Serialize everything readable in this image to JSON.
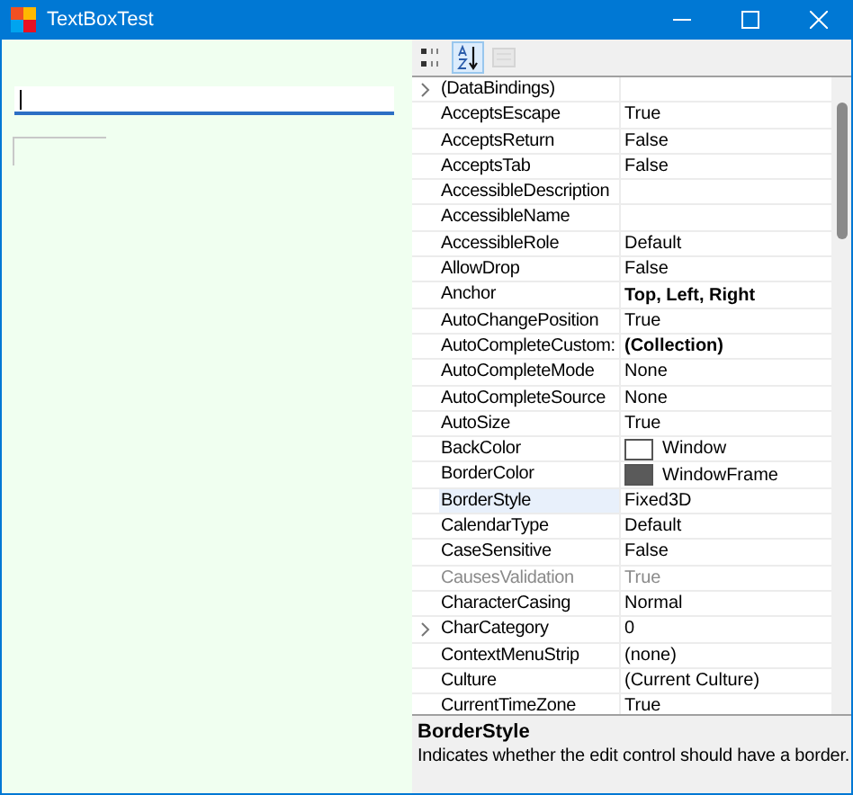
{
  "window": {
    "title": "TextBoxTest"
  },
  "form": {
    "textbox_focused": true
  },
  "toolbar": [
    {
      "kind": "categorized",
      "selected": false,
      "disabled": false
    },
    {
      "kind": "alphabetical",
      "selected": true,
      "disabled": false
    },
    {
      "kind": "pages",
      "selected": false,
      "disabled": true
    }
  ],
  "properties": [
    {
      "name": "(DataBindings)",
      "kind": "plain",
      "expandable": true,
      "disabled": false,
      "selected": false
    },
    {
      "name": "AcceptsEscape",
      "value": "True",
      "kind": "plain",
      "disabled": false,
      "selected": false
    },
    {
      "name": "AcceptsReturn",
      "value": "False",
      "kind": "plain",
      "disabled": false,
      "selected": false
    },
    {
      "name": "AcceptsTab",
      "value": "False",
      "kind": "plain",
      "disabled": false,
      "selected": false
    },
    {
      "name": "AccessibleDescription",
      "kind": "plain",
      "disabled": false,
      "selected": false
    },
    {
      "name": "AccessibleName",
      "kind": "plain",
      "disabled": false,
      "selected": false
    },
    {
      "name": "AccessibleRole",
      "value": "Default",
      "kind": "plain",
      "disabled": false,
      "selected": false
    },
    {
      "name": "AllowDrop",
      "value": "False",
      "kind": "plain",
      "disabled": false,
      "selected": false
    },
    {
      "name": "Anchor",
      "value": "Top, Left, Right",
      "kind": "bold",
      "disabled": false,
      "selected": false
    },
    {
      "name": "AutoChangePosition",
      "value": "True",
      "kind": "plain",
      "disabled": false,
      "selected": false
    },
    {
      "name": "AutoCompleteCustom:",
      "value": "(Collection)",
      "kind": "bold",
      "disabled": false,
      "selected": false
    },
    {
      "name": "AutoCompleteMode",
      "value": "None",
      "kind": "plain",
      "disabled": false,
      "selected": false
    },
    {
      "name": "AutoCompleteSource",
      "value": "None",
      "kind": "plain",
      "disabled": false,
      "selected": false
    },
    {
      "name": "AutoSize",
      "value": "True",
      "kind": "plain",
      "disabled": false,
      "selected": false
    },
    {
      "name": "BackColor",
      "value": "Window",
      "kind": "swatch",
      "color": "#ffffff",
      "disabled": false,
      "selected": false
    },
    {
      "name": "BorderColor",
      "value": "WindowFrame",
      "kind": "swatch",
      "color": "#5a5a5a",
      "disabled": false,
      "selected": false
    },
    {
      "name": "BorderStyle",
      "value": "Fixed3D",
      "kind": "plain",
      "disabled": false,
      "selected": true
    },
    {
      "name": "CalendarType",
      "value": "Default",
      "kind": "plain",
      "disabled": false,
      "selected": false
    },
    {
      "name": "CaseSensitive",
      "value": "False",
      "kind": "plain",
      "disabled": false,
      "selected": false
    },
    {
      "name": "CausesValidation",
      "value": "True",
      "kind": "plain",
      "disabled": true,
      "selected": false
    },
    {
      "name": "CharacterCasing",
      "value": "Normal",
      "kind": "plain",
      "disabled": false,
      "selected": false
    },
    {
      "name": "CharCategory",
      "value": "0",
      "kind": "plain",
      "expandable": true,
      "disabled": false,
      "selected": false
    },
    {
      "name": "ContextMenuStrip",
      "value": "(none)",
      "kind": "plain",
      "disabled": false,
      "selected": false
    },
    {
      "name": "Culture",
      "value": "(Current Culture)",
      "kind": "plain",
      "disabled": false,
      "selected": false
    },
    {
      "name": "CurrentTimeZone",
      "value": "True",
      "kind": "plain",
      "disabled": false,
      "selected": false
    }
  ],
  "description": {
    "title": "BorderStyle",
    "text": "Indicates whether the edit control should have a border."
  }
}
